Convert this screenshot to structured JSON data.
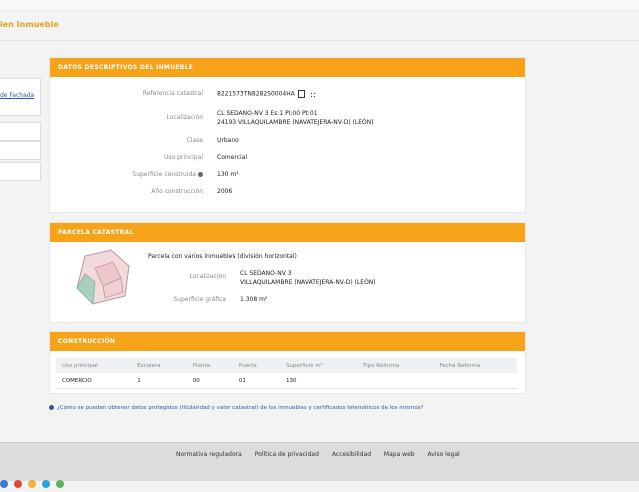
{
  "page": {
    "title": "ien Inmueble"
  },
  "left": {
    "link": "de Fachada"
  },
  "descriptivos": {
    "header": "DATOS DESCRIPTIVOS DEL INMUEBLE",
    "rows": [
      {
        "label": "Referencia catastral",
        "value": "8221573TN8282S0004HA"
      },
      {
        "label": "Localización",
        "value": "CL SEDANO-NV 3 Es:1 Pl:00 Pt:01",
        "value2": "24193 VILLAQUILAMBRE (NAVATEJERA-NV-D) (LEÓN)"
      },
      {
        "label": "Clase",
        "value": "Urbano"
      },
      {
        "label": "Uso principal",
        "value": "Comercial"
      },
      {
        "label": "Superficie construida",
        "value": "130 m²"
      },
      {
        "label": "Año construcción",
        "value": "2006"
      }
    ]
  },
  "parcela": {
    "header": "PARCELA CATASTRAL",
    "note": "Parcela con varios inmuebles (división horizontal)",
    "loc_label": "Localización",
    "loc_value": "CL SEDANO-NV 3",
    "loc_value2": "VILLAQUILAMBRE (NAVATEJERA-NV-D) (LEÓN)",
    "sup_label": "Superficie gráfica",
    "sup_value": "1.308 m²"
  },
  "construccion": {
    "header": "CONSTRUCCIÓN",
    "columns": [
      "Uso principal",
      "Escalera",
      "Planta",
      "Puerta",
      "Superficie m²",
      "Tipo Reforma",
      "Fecha Reforma"
    ],
    "row": [
      "COMERCIO",
      "1",
      "00",
      "01",
      "130",
      "",
      ""
    ]
  },
  "help": {
    "text": "¿Cómo se pueden obtener datos protegidos (titularidad y valor catastral) de los inmuebles y certificados telemáticos de los mismos?"
  },
  "footer": {
    "links": [
      "Normativa reguladora",
      "Política de privacidad",
      "Accesibilidad",
      "Mapa web",
      "Aviso legal"
    ]
  },
  "colors": {
    "accent": "#f6a31a",
    "link": "#2a5aa8"
  }
}
